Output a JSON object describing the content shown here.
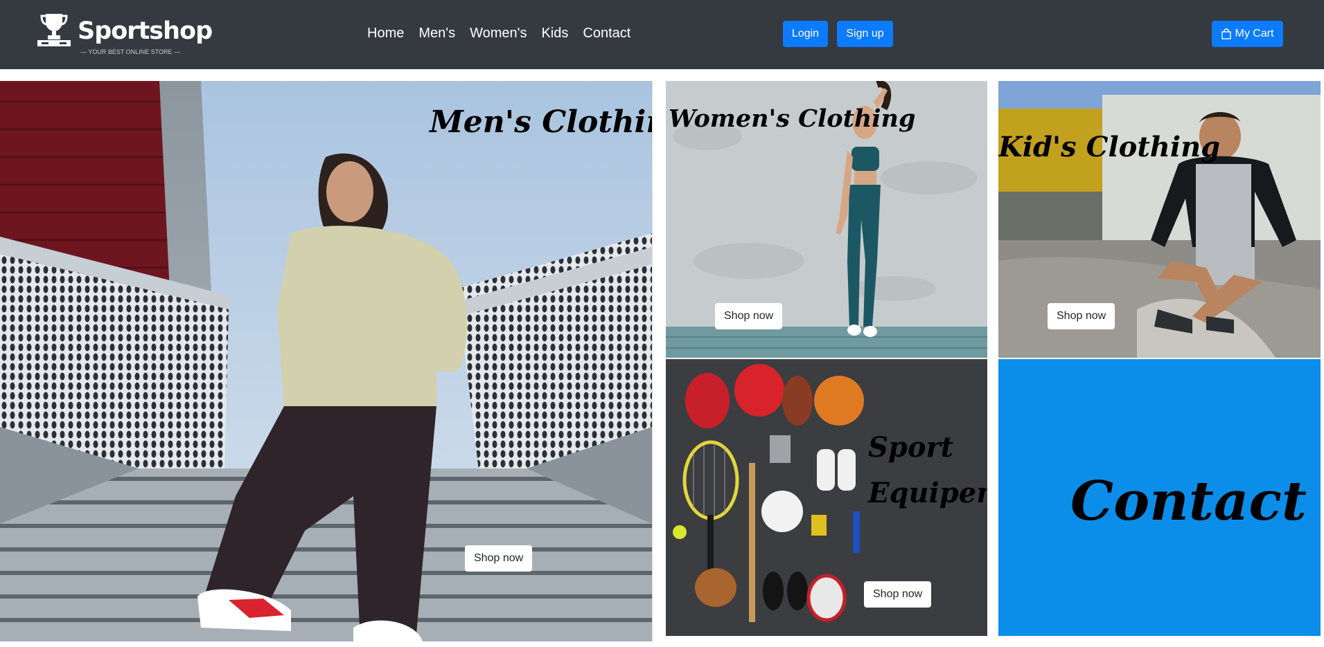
{
  "brand": {
    "name": "Sportshop",
    "tagline": "— YOUR BEST ONLINE STORE —"
  },
  "nav": {
    "items": [
      {
        "label": "Home"
      },
      {
        "label": "Men's"
      },
      {
        "label": "Women's"
      },
      {
        "label": "Kids"
      },
      {
        "label": "Contact"
      }
    ]
  },
  "auth": {
    "login_label": "Login",
    "signup_label": "Sign up"
  },
  "cart": {
    "label": "My Cart",
    "icon": "shopping-bag-icon"
  },
  "tiles": {
    "men": {
      "title": "Men's Clothing",
      "button": "Shop now"
    },
    "women": {
      "title": "Women's Clothing",
      "button": "Shop now"
    },
    "kids": {
      "title": "Kid's Clothing",
      "button": "Shop now"
    },
    "sport": {
      "title_line1": "Sport",
      "title_line2": "Equipement",
      "button": "Shop now"
    },
    "contact": {
      "title": "Contact"
    }
  },
  "colors": {
    "navbar": "#343a40",
    "primary": "#0d7bfd",
    "contact_bg": "#0b8ee9"
  }
}
